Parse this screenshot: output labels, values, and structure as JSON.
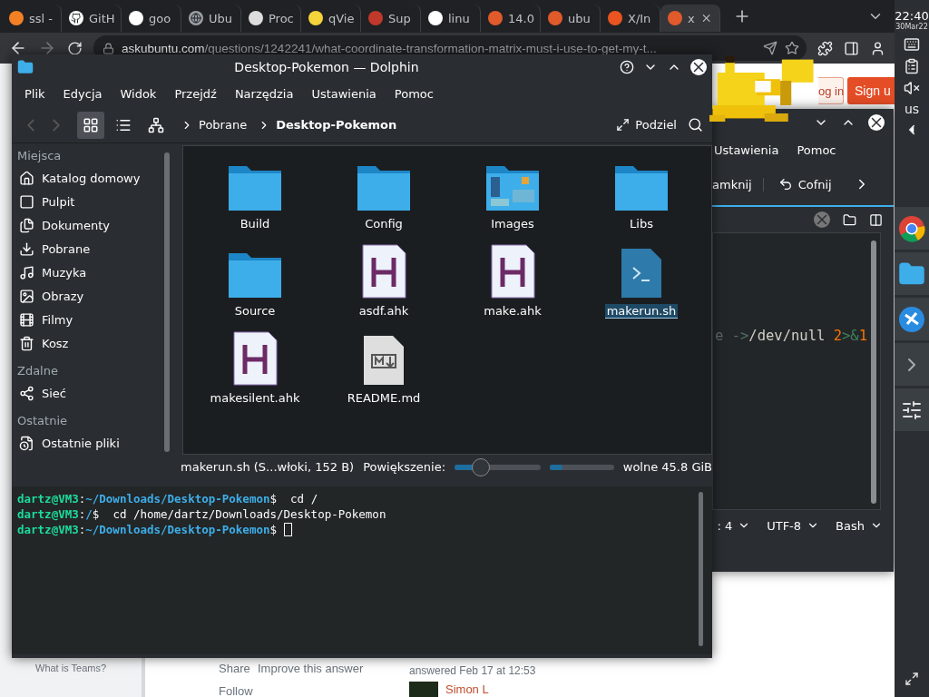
{
  "browser": {
    "tabs": [
      {
        "title": "ssl -",
        "selected": false
      },
      {
        "title": "GitH",
        "selected": false
      },
      {
        "title": "goo",
        "selected": false
      },
      {
        "title": "Ubu",
        "selected": false
      },
      {
        "title": "Proc",
        "selected": false
      },
      {
        "title": "qVie",
        "selected": false
      },
      {
        "title": "Sup",
        "selected": false
      },
      {
        "title": "linu",
        "selected": false
      },
      {
        "title": "14.0",
        "selected": false
      },
      {
        "title": "ubu",
        "selected": false
      },
      {
        "title": "X/In",
        "selected": false
      },
      {
        "title": "x",
        "selected": true
      }
    ],
    "address": {
      "host": "askubuntu.com",
      "path": "/questions/1242241/what-coordinate-transformation-matrix-must-i-use-to-get-my-t..."
    },
    "page": {
      "login": "og in",
      "signup": "Sign u",
      "teams": "What is Teams?",
      "share": "Share",
      "improve": "Improve this answer",
      "follow": "Follow",
      "answered": "answered Feb 17 at 12:53",
      "user": "Simon L"
    }
  },
  "editor": {
    "menu": [
      "Ustawienia",
      "Pomoc"
    ],
    "toolbar": [
      {
        "label": "amknij",
        "kind": "text"
      },
      {
        "label": "Cofnij",
        "kind": "undo"
      }
    ],
    "code": [
      {
        "text": "e ",
        "color": "#5b6b63"
      },
      {
        "text": "->",
        "color": "#4f6f5f"
      },
      {
        "text": "/dev/null ",
        "color": "#cfcfc2"
      },
      {
        "text": "2",
        "color": "#f67400"
      },
      {
        "text": ">&",
        "color": "#3f8058"
      },
      {
        "text": "1",
        "color": "#f67400"
      }
    ],
    "status": [
      ": 4",
      "UTF-8",
      "Bash"
    ]
  },
  "dolphin": {
    "title": "Desktop-Pokemon — Dolphin",
    "menu": [
      "Plik",
      "Edycja",
      "Widok",
      "Przejdź",
      "Narzędzia",
      "Ustawienia",
      "Pomoc"
    ],
    "views": [
      {
        "kind": "icons",
        "selected": true
      },
      {
        "kind": "details",
        "selected": false
      },
      {
        "kind": "tree",
        "selected": false
      }
    ],
    "breadcrumb": [
      {
        "label": "Pobrane",
        "selected": false
      },
      {
        "label": "Desktop-Pokemon",
        "selected": true
      }
    ],
    "split": "Podziel",
    "places": [
      {
        "heading": "Miejsca",
        "items": [
          "Katalog domowy",
          "Pulpit",
          "Dokumenty",
          "Pobrane",
          "Muzyka",
          "Obrazy",
          "Filmy",
          "Kosz"
        ]
      },
      {
        "heading": "Zdalne",
        "items": [
          "Sieć"
        ]
      },
      {
        "heading": "Ostatnie",
        "items": [
          "Ostatnie pliki"
        ]
      }
    ],
    "files": [
      {
        "name": "Build",
        "kind": "folder",
        "selected": false
      },
      {
        "name": "Config",
        "kind": "folder",
        "selected": false
      },
      {
        "name": "Images",
        "kind": "image-folder",
        "selected": false
      },
      {
        "name": "Libs",
        "kind": "folder",
        "selected": false
      },
      {
        "name": "Source",
        "kind": "folder",
        "selected": false
      },
      {
        "name": "asdf.ahk",
        "kind": "ahk",
        "selected": false
      },
      {
        "name": "make.ahk",
        "kind": "ahk",
        "selected": false
      },
      {
        "name": "makerun.sh",
        "kind": "script",
        "selected": true
      },
      {
        "name": "makesilent.ahk",
        "kind": "ahk",
        "selected": false
      },
      {
        "name": "README.md",
        "kind": "markdown",
        "selected": false
      }
    ],
    "status": {
      "info": "makerun.sh (S...włoki, 152 B)",
      "zoom_label": "Powiększenie:",
      "zoom": {
        "level": 0.3
      },
      "space": {
        "level": 0.2
      },
      "free": "wolne 45.8 GiB"
    },
    "terminal": [
      {
        "user": "dartz@VM3",
        "sep": ":",
        "path": "~/Downloads/Desktop-Pokemon",
        "prompt": "$",
        "command": "cd /",
        "cursor": false
      },
      {
        "user": "dartz@VM3",
        "sep": ":",
        "path": "/",
        "prompt": "$",
        "command": "cd /home/dartz/Downloads/Desktop-Pokemon",
        "cursor": false
      },
      {
        "user": "dartz@VM3",
        "sep": ":",
        "path": "~/Downloads/Desktop-Pokemon",
        "prompt": "$",
        "cursor": true
      }
    ]
  },
  "panel": {
    "time": "22:40",
    "date": "30Mar22",
    "layout": "us"
  }
}
